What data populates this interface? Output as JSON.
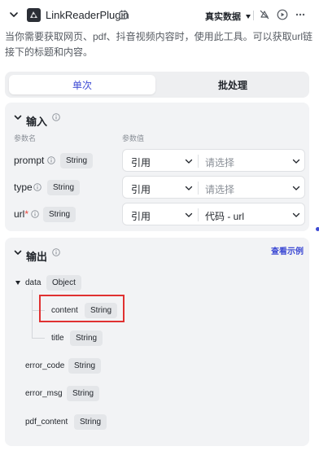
{
  "header": {
    "title": "LinkReaderPlugin",
    "mode_label": "真实数据",
    "icons": [
      "chevron-down-icon",
      "plugin-logo-icon",
      "debug-icon",
      "no-notification-icon",
      "run-icon",
      "more-icon"
    ]
  },
  "description": "当你需要获取网页、pdf、抖音视频内容时，使用此工具。可以获取url链接下的标题和内容。",
  "tabs": [
    {
      "label": "单次",
      "active": true
    },
    {
      "label": "批处理",
      "active": false
    }
  ],
  "input": {
    "title": "输入",
    "col_name": "参数名",
    "col_value": "参数值",
    "params": [
      {
        "name": "prompt",
        "required": false,
        "type": "String",
        "ref": "引用",
        "value": "请选择",
        "filled": false
      },
      {
        "name": "type",
        "required": false,
        "type": "String",
        "ref": "引用",
        "value": "请选择",
        "filled": false
      },
      {
        "name": "url",
        "required": true,
        "type": "String",
        "ref": "引用",
        "value": "代码 - url",
        "filled": true
      }
    ]
  },
  "output": {
    "title": "输出",
    "view_example": "查看示例",
    "data": {
      "name": "data",
      "type": "Object"
    },
    "children": [
      {
        "name": "content",
        "type": "String"
      },
      {
        "name": "title",
        "type": "String"
      }
    ],
    "fields": [
      {
        "name": "error_code",
        "type": "String"
      },
      {
        "name": "error_msg",
        "type": "String"
      },
      {
        "name": "pdf_content",
        "type": "String"
      }
    ]
  },
  "colors": {
    "accent": "#3d4ad4",
    "highlight": "#e03131",
    "card_bg": "#f2f3f5"
  }
}
